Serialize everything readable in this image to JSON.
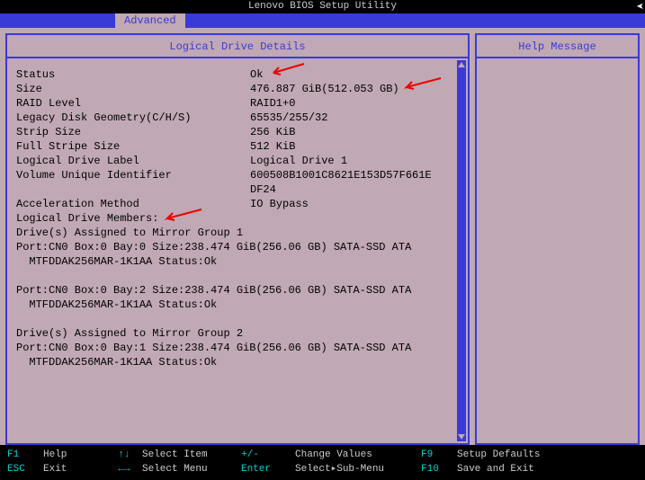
{
  "window_title": "Lenovo BIOS Setup Utility",
  "active_tab": "Advanced",
  "left_panel_title": "Logical Drive Details",
  "right_panel_title": "Help Message",
  "details": {
    "status_k": "Status",
    "status_v": "Ok",
    "size_k": "Size",
    "size_v": "476.887 GiB(512.053 GB)",
    "raid_k": "RAID Level",
    "raid_v": "RAID1+0",
    "geom_k": "Legacy Disk Geometry(C/H/S)",
    "geom_v": "65535/255/32",
    "strip_k": "Strip Size",
    "strip_v": "256 KiB",
    "fstrip_k": "Full Stripe Size",
    "fstrip_v": "512 KiB",
    "label_k": "Logical Drive Label",
    "label_v": "Logical Drive 1",
    "vuid_k": "Volume Unique Identifier",
    "vuid_v1": "600508B1001C8621E153D57F661E",
    "vuid_v2": "DF24",
    "accel_k": "Acceleration Method",
    "accel_v": "IO Bypass",
    "members_k": "Logical Drive Members:",
    "mirror1": "Drive(s) Assigned to Mirror Group 1",
    "d1": "Port:CN0 Box:0 Bay:0 Size:238.474 GiB(256.06 GB) SATA-SSD ATA",
    "d1b": "  MTFDDAK256MAR-1K1AA Status:Ok",
    "d2": "Port:CN0 Box:0 Bay:2 Size:238.474 GiB(256.06 GB) SATA-SSD ATA",
    "d2b": "  MTFDDAK256MAR-1K1AA Status:Ok",
    "mirror2": "Drive(s) Assigned to Mirror Group 2",
    "d3": "Port:CN0 Box:0 Bay:1 Size:238.474 GiB(256.06 GB) SATA-SSD ATA",
    "d3b": "  MTFDDAK256MAR-1K1AA Status:Ok"
  },
  "footer": {
    "f1": "F1",
    "f1d": "Help",
    "ud": "↑↓",
    "udd": "Select Item",
    "pm": "+/-",
    "pmd": "Change Values",
    "f9": "F9",
    "f9d": "Setup Defaults",
    "esc": "ESC",
    "escd": "Exit",
    "lr": "←→",
    "lrd": "Select Menu",
    "ent": "Enter",
    "entd": "Select▸Sub-Menu",
    "f10": "F10",
    "f10d": "Save and Exit"
  }
}
